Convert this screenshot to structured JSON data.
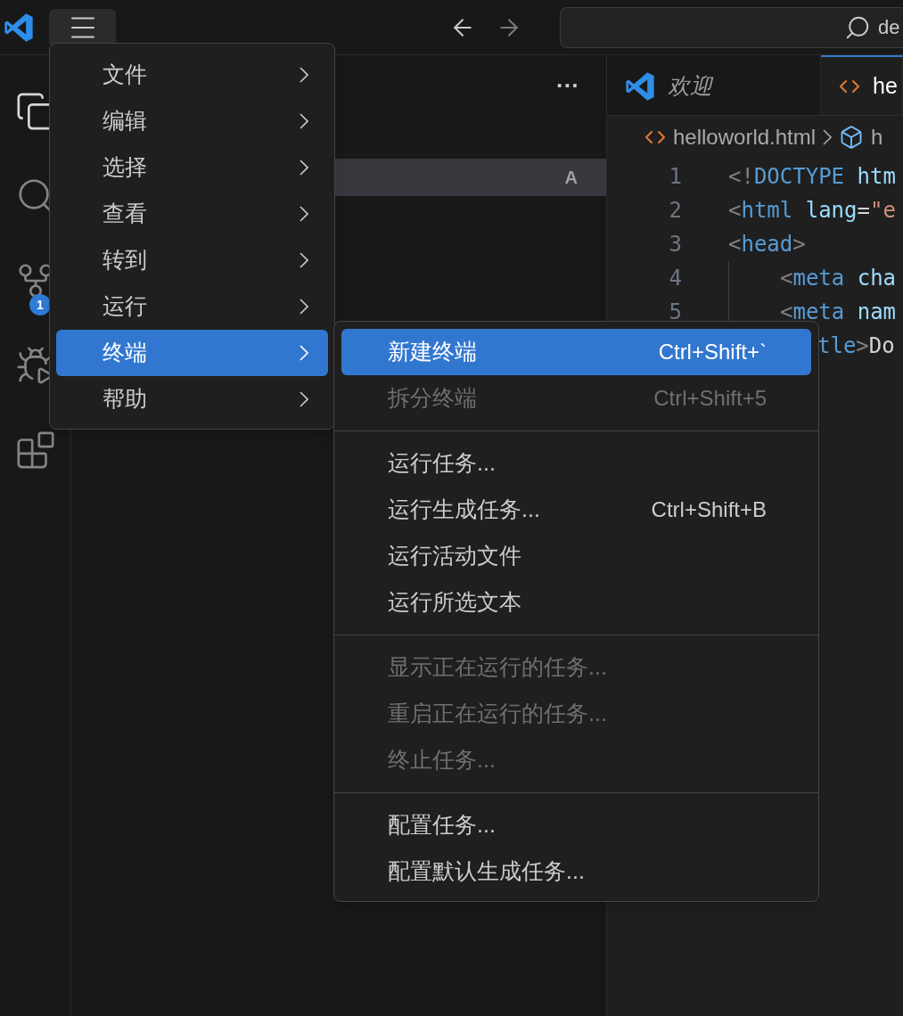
{
  "title_bar": {
    "search": {
      "value": "de"
    }
  },
  "activity_bar": {
    "items": [
      {
        "kind": "files",
        "selected": true
      },
      {
        "kind": "search",
        "selected": false
      },
      {
        "kind": "source_control",
        "selected": false,
        "badge": "1"
      },
      {
        "kind": "run",
        "selected": false
      },
      {
        "kind": "extensions",
        "selected": false
      }
    ]
  },
  "sidebar": {
    "more": "···",
    "rows": [
      {
        "badge": "A",
        "selected": true
      }
    ]
  },
  "tabs": [
    {
      "label": "欢迎",
      "kind": "welcome",
      "preview": true,
      "selected": false
    },
    {
      "label": "he",
      "kind": "html",
      "preview": false,
      "selected": true
    }
  ],
  "breadcrumb": {
    "file": "helloworld.html",
    "symbol": "h"
  },
  "code_lines": [
    {
      "number": "1",
      "tokens": [
        {
          "text": "<!",
          "kind": "punct"
        },
        {
          "text": "DOCTYPE",
          "kind": "tag"
        },
        {
          "text": " htm",
          "kind": "attr"
        }
      ]
    },
    {
      "number": "2",
      "tokens": [
        {
          "text": "<",
          "kind": "punct"
        },
        {
          "text": "html",
          "kind": "tag"
        },
        {
          "text": " lang",
          "kind": "attr"
        },
        {
          "text": "=",
          "kind": "text"
        },
        {
          "text": "\"e",
          "kind": "string"
        }
      ]
    },
    {
      "number": "3",
      "tokens": [
        {
          "text": "<",
          "kind": "punct"
        },
        {
          "text": "head",
          "kind": "tag"
        },
        {
          "text": ">",
          "kind": "punct"
        }
      ]
    },
    {
      "number": "4",
      "indent": true,
      "tokens": [
        {
          "text": "<",
          "kind": "punct"
        },
        {
          "text": "meta",
          "kind": "tag"
        },
        {
          "text": " cha",
          "kind": "attr"
        }
      ]
    },
    {
      "number": "5",
      "indent": true,
      "tokens": [
        {
          "text": "<",
          "kind": "punct"
        },
        {
          "text": "meta",
          "kind": "tag"
        },
        {
          "text": " nam",
          "kind": "attr"
        }
      ]
    },
    {
      "indent": true,
      "covered": true,
      "tokens": [
        {
          "text": "tle",
          "kind": "tag"
        },
        {
          "text": ">",
          "kind": "punct"
        },
        {
          "text": "Do",
          "kind": "text"
        }
      ]
    }
  ],
  "main_menu": {
    "items": [
      {
        "label": "文件",
        "selected": false
      },
      {
        "label": "编辑",
        "selected": false
      },
      {
        "label": "选择",
        "selected": false
      },
      {
        "label": "查看",
        "selected": false
      },
      {
        "label": "转到",
        "selected": false
      },
      {
        "label": "运行",
        "selected": false
      },
      {
        "label": "终端",
        "selected": true
      },
      {
        "label": "帮助",
        "selected": false
      }
    ]
  },
  "terminal_menu": {
    "groups": [
      {
        "items": [
          {
            "label": "新建终端",
            "shortcut": "Ctrl+Shift+`",
            "selected": true,
            "disabled": false
          },
          {
            "label": "拆分终端",
            "shortcut": "Ctrl+Shift+5",
            "selected": false,
            "disabled": true
          }
        ]
      },
      {
        "items": [
          {
            "label": "运行任务...",
            "selected": false,
            "disabled": false
          },
          {
            "label": "运行生成任务...",
            "shortcut": "Ctrl+Shift+B",
            "selected": false,
            "disabled": false
          },
          {
            "label": "运行活动文件",
            "selected": false,
            "disabled": false
          },
          {
            "label": "运行所选文本",
            "selected": false,
            "disabled": false
          }
        ]
      },
      {
        "items": [
          {
            "label": "显示正在运行的任务...",
            "selected": false,
            "disabled": true
          },
          {
            "label": "重启正在运行的任务...",
            "selected": false,
            "disabled": true
          },
          {
            "label": "终止任务...",
            "selected": false,
            "disabled": true
          }
        ]
      },
      {
        "items": [
          {
            "label": "配置任务...",
            "selected": false,
            "disabled": false
          },
          {
            "label": "配置默认生成任务...",
            "selected": false,
            "disabled": false
          }
        ]
      }
    ]
  }
}
